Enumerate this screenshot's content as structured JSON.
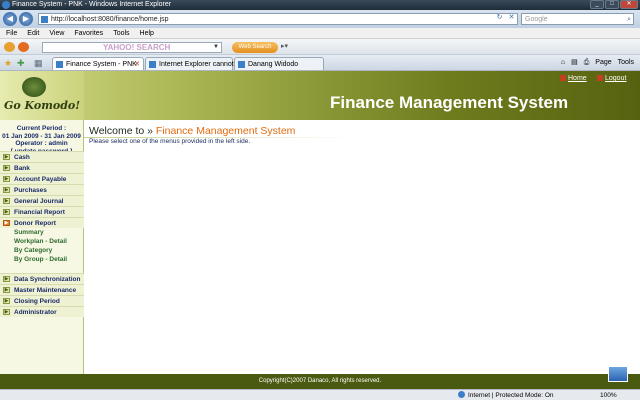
{
  "browser": {
    "window_title": "Finance System - PNK - Windows Internet Explorer",
    "address": "http://localhost:8080/finance/home.jsp",
    "search_placeholder": "Google",
    "menu": [
      "File",
      "Edit",
      "View",
      "Favorites",
      "Tools",
      "Help"
    ],
    "toolbar": {
      "yahoo_logo": "YAHOO! SEARCH",
      "web_search_label": "Web Search"
    },
    "tabs": [
      {
        "label": "Finance System - PNK",
        "active": true
      },
      {
        "label": "Internet Explorer cannot di...",
        "active": false
      },
      {
        "label": "Danang Widodo",
        "active": false
      }
    ],
    "commands": {
      "page": "Page",
      "tools": "Tools"
    },
    "status": {
      "zone": "Internet | Protected Mode: On",
      "zoom": "100%"
    }
  },
  "header": {
    "logo_text": "Go Komodo!",
    "title": "Finance Management System",
    "home_link": "Home",
    "logout_link": "Logout"
  },
  "sidebar": {
    "period_label": "Current Period :",
    "period_value": "01 Jan 2009 - 31 Jan 2009",
    "operator": "Operator : admin",
    "update_password": "[ update password ]",
    "menu_top": [
      {
        "label": "Cash"
      },
      {
        "label": "Bank"
      },
      {
        "label": "Account Payable"
      },
      {
        "label": "Purchases"
      },
      {
        "label": "General Journal"
      },
      {
        "label": "Financial Report"
      },
      {
        "label": "Donor Report"
      }
    ],
    "donor_submenu": [
      "Summary",
      "Workplan - Detail",
      "By Category",
      "By Group - Detail"
    ],
    "menu_bottom": [
      {
        "label": "Data Synchronization"
      },
      {
        "label": "Master Maintenance"
      },
      {
        "label": "Closing Period"
      },
      {
        "label": "Administrator"
      }
    ]
  },
  "main": {
    "welcome_prefix": "Welcome to »",
    "welcome_highlight": "Finance Management System",
    "instruction": "Please select one of the menus provided in the left side."
  },
  "footer": {
    "copyright": "Copyright(C)2007 Danaco, All rights reserved."
  },
  "colors": {
    "banner_dark": "#56620f",
    "highlight": "#e26b10",
    "footer_bg": "#4a5a10",
    "menu_text": "#1a2a6a"
  }
}
